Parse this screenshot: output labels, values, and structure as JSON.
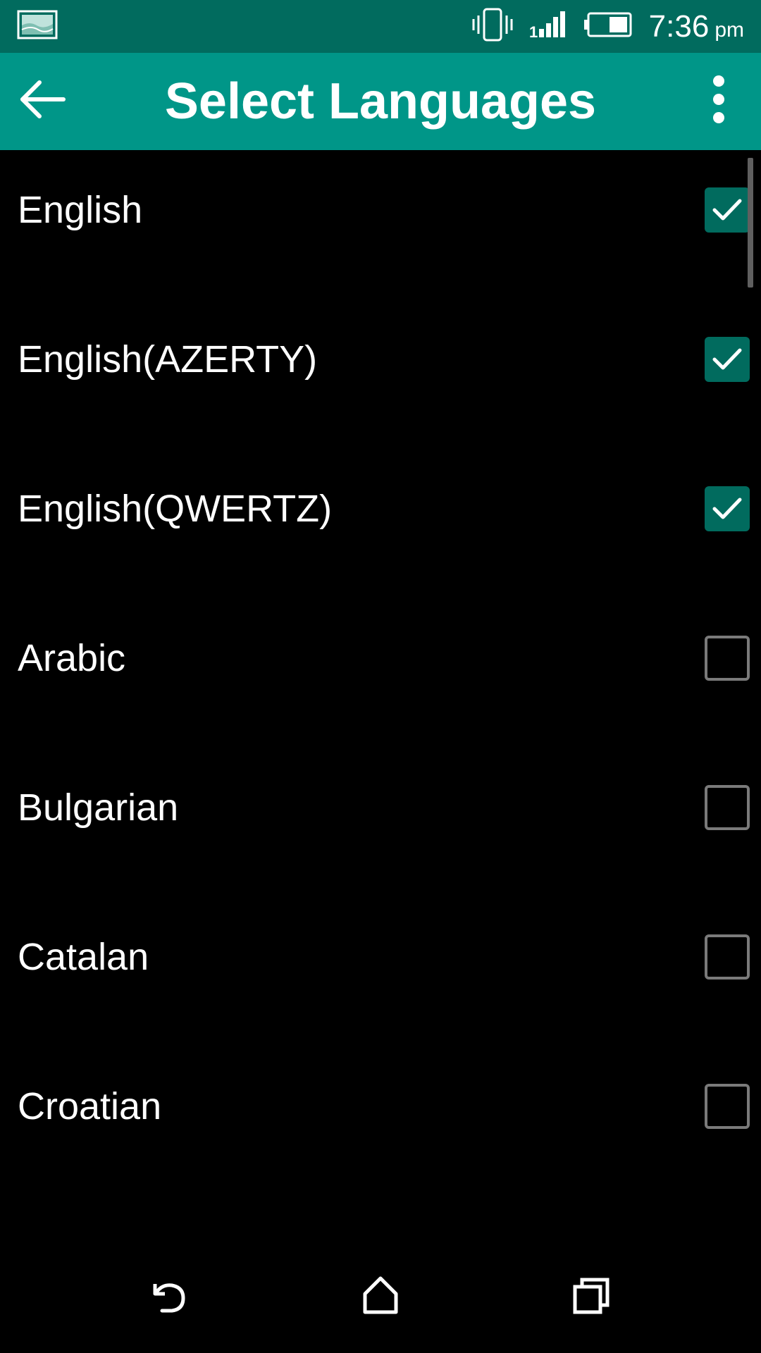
{
  "status_bar": {
    "time": "7:36",
    "ampm": "pm",
    "icons": [
      "gallery-notification-icon",
      "vibrate-icon",
      "signal-icon",
      "battery-icon"
    ]
  },
  "app_bar": {
    "title": "Select Languages",
    "back_icon": "arrow-back-icon",
    "menu_icon": "more-vert-icon"
  },
  "languages": [
    {
      "label": "English",
      "checked": true
    },
    {
      "label": "English(AZERTY)",
      "checked": true
    },
    {
      "label": "English(QWERTZ)",
      "checked": true
    },
    {
      "label": "Arabic",
      "checked": false
    },
    {
      "label": "Bulgarian",
      "checked": false
    },
    {
      "label": "Catalan",
      "checked": false
    },
    {
      "label": "Croatian",
      "checked": false
    }
  ],
  "colors": {
    "status_bar": "#016b5e",
    "app_bar": "#009688",
    "checkbox_checked": "#016b5e",
    "checkbox_unchecked_border": "#7a7a7a",
    "background": "#000000"
  },
  "nav_bar": {
    "icons": [
      "back-nav-icon",
      "home-nav-icon",
      "recents-nav-icon"
    ]
  }
}
